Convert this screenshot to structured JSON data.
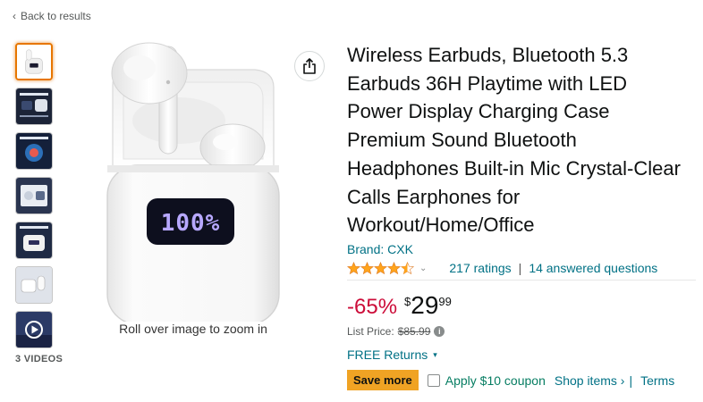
{
  "nav": {
    "back_label": "Back to results"
  },
  "gallery": {
    "videos_label": "3 VIDEOS",
    "zoom_hint": "Roll over image to zoom in"
  },
  "product": {
    "title": "Wireless Earbuds, Bluetooth 5.3 Earbuds 36H Playtime with LED Power Display Charging Case Premium Sound Bluetooth Headphones Built-in Mic Crystal-Clear Calls Earphones for Workout/Home/Office",
    "brand": "Brand: CXK",
    "rating": {
      "stars": 4.5,
      "ratings_count": "217 ratings",
      "answered": "14 answered questions"
    },
    "led_display": "100%"
  },
  "pricing": {
    "discount": "-65%",
    "currency": "$",
    "whole": "29",
    "fraction": "99",
    "list_price_label": "List Price:",
    "list_price": "$85.99",
    "free_returns": "FREE Returns"
  },
  "coupon": {
    "badge": "Save more",
    "label": "Apply $10 coupon",
    "shop_items": "Shop items ›",
    "separator": "|",
    "terms": "Terms"
  },
  "colors": {
    "link": "#007185",
    "discount": "#cc0c39",
    "star": "#ffa41c",
    "badge": "#f0a324",
    "coupon_green": "#067d62"
  }
}
